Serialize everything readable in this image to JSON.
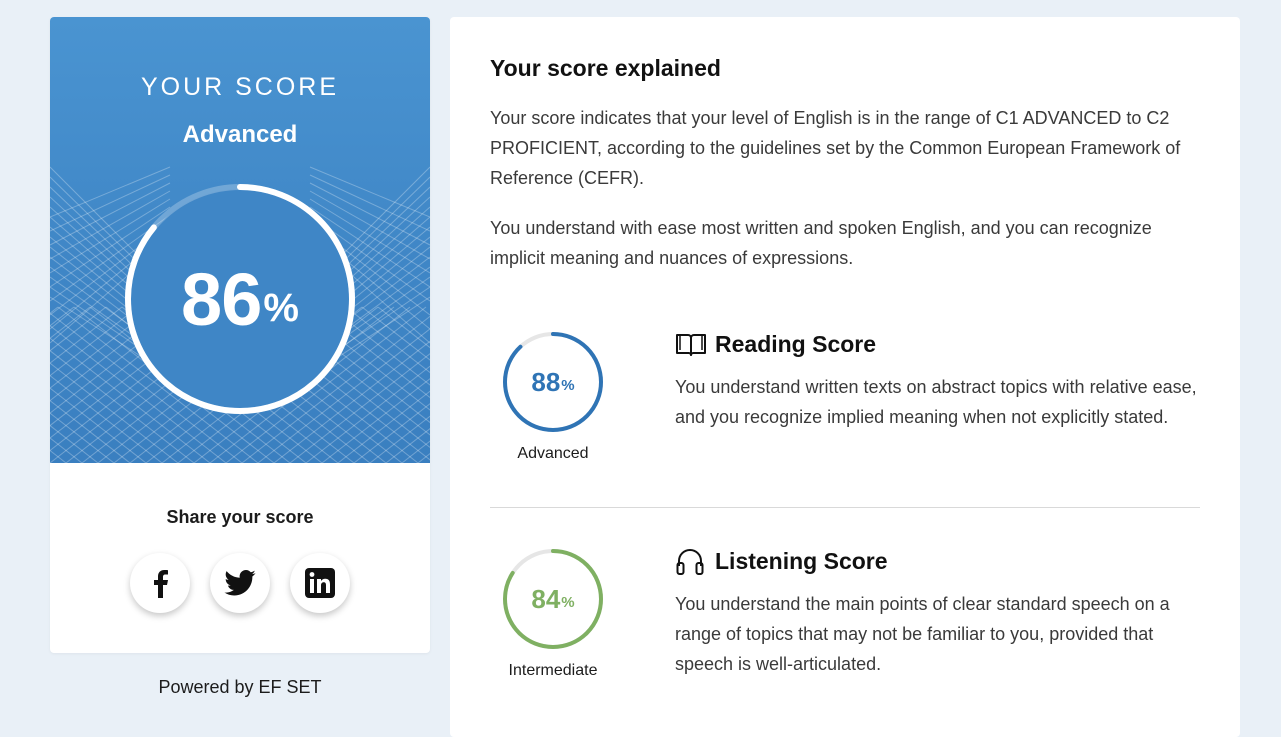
{
  "score_card": {
    "heading": "YOUR SCORE",
    "level": "Advanced",
    "percent": 86,
    "percent_label": "86",
    "percent_symbol": "%",
    "accent_color": "#3f86c6"
  },
  "share": {
    "title": "Share your score",
    "buttons": [
      {
        "name": "facebook",
        "icon": "facebook-icon"
      },
      {
        "name": "twitter",
        "icon": "twitter-icon"
      },
      {
        "name": "linkedin",
        "icon": "linkedin-icon"
      }
    ]
  },
  "powered_by": "Powered by EF SET",
  "explanation": {
    "title": "Your score explained",
    "paragraph1": "Your score indicates that your level of English is in the range of C1 ADVANCED to C2 PROFICIENT, according to the guidelines set by the Common European Framework of Reference (CEFR).",
    "paragraph2": "You understand with ease most written and spoken English, and you can recognize implicit meaning and nuances of expressions."
  },
  "reading": {
    "title": "Reading Score",
    "icon": "book-icon",
    "percent": 88,
    "percent_label": "88",
    "percent_symbol": "%",
    "level": "Advanced",
    "color": "#2f74b5",
    "description": "You understand written texts on abstract topics with relative ease, and you recognize implied meaning when not explicitly stated."
  },
  "listening": {
    "title": "Listening Score",
    "icon": "headphones-icon",
    "percent": 84,
    "percent_label": "84",
    "percent_symbol": "%",
    "level": "Intermediate",
    "color": "#7fb062",
    "description": "You understand the main points of clear standard speech on a range of topics that may not be familiar to you, provided that speech is well-articulated."
  }
}
